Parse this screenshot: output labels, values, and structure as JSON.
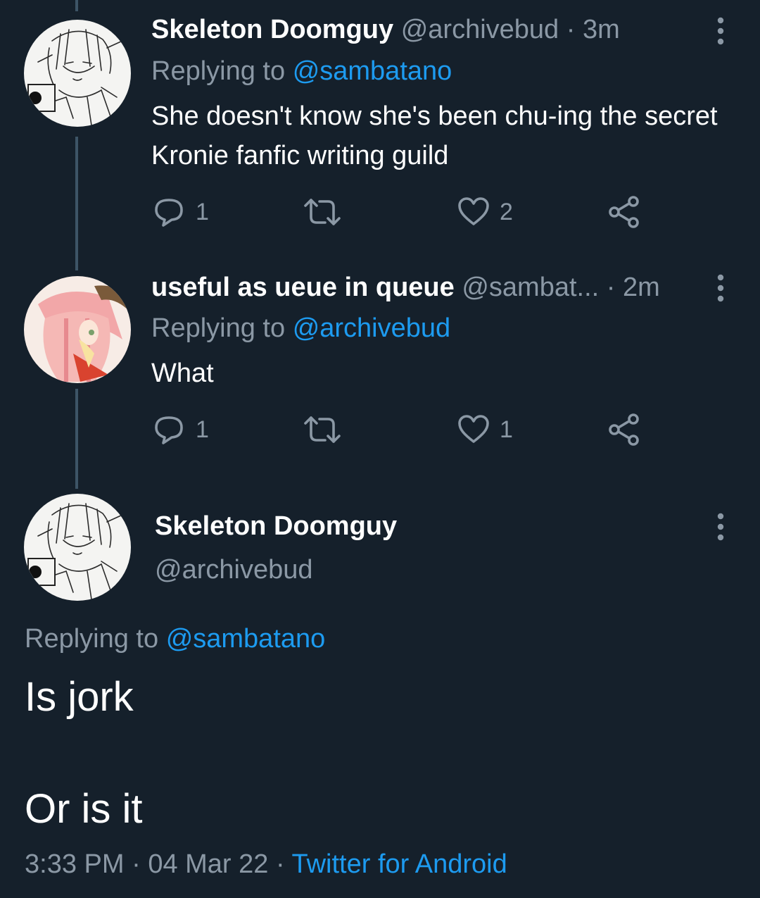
{
  "tweets": [
    {
      "name": "Skeleton Doomguy",
      "handle": "@archivebud",
      "time": "3m",
      "separator": "·",
      "replying_prefix": "Replying to",
      "replying_handle": "@sambatano",
      "text": "She doesn't know she's been chu-ing the secret Kronie fanfic writing guild",
      "reply_count": "1",
      "like_count": "2"
    },
    {
      "name": "useful as ueue in queue",
      "handle": "@sambat...",
      "time": "2m",
      "separator": "·",
      "replying_prefix": "Replying to",
      "replying_handle": "@archivebud",
      "text": "What",
      "reply_count": "1",
      "like_count": "1"
    }
  ],
  "main_tweet": {
    "name": "Skeleton Doomguy",
    "handle": "@archivebud",
    "replying_prefix": "Replying to",
    "replying_handle": "@sambatano",
    "text_line_1": "Is jork",
    "text_line_2": "Or is it",
    "time": "3:33 PM",
    "date": "04 Mar 22",
    "separator": "·",
    "source": "Twitter for Android"
  },
  "icons": {
    "reply": "reply-icon",
    "retweet": "retweet-icon",
    "like": "heart-icon",
    "share": "share-icon",
    "more": "more-vertical-icon"
  },
  "colors": {
    "background": "#15202b",
    "text": "#ffffff",
    "muted": "#8b98a5",
    "link": "#1d9bf0",
    "thread_line": "#3d5466"
  }
}
